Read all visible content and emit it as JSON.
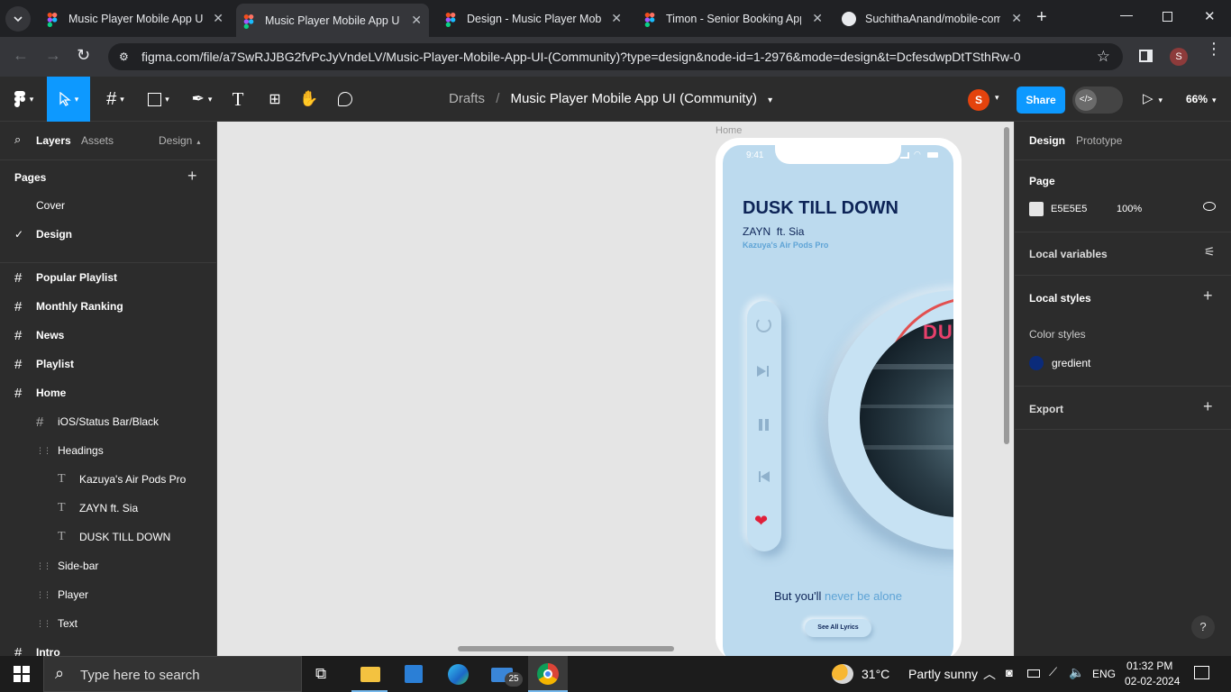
{
  "browser": {
    "tabs": [
      {
        "title": "Music Player Mobile App UI",
        "icon": "figma-icon",
        "active": false
      },
      {
        "title": "Music Player Mobile App UI",
        "icon": "figma-icon",
        "active": true
      },
      {
        "title": "Design - Music Player Mobil",
        "icon": "figma-icon",
        "active": false
      },
      {
        "title": "Timon - Senior Booking App",
        "icon": "figma-icon",
        "active": false
      },
      {
        "title": "SuchithaAnand/mobile-com",
        "icon": "github-icon",
        "active": false
      }
    ],
    "url": "figma.com/file/a7SwRJJBG2fvPcJyVndeLV/Music-Player-Mobile-App-UI-(Community)?type=design&node-id=1-2976&mode=design&t=DcfesdwpDtTSthRw-0",
    "profile_initial": "S"
  },
  "figma": {
    "breadcrumb_root": "Drafts",
    "breadcrumb_sep": "/",
    "file_name": "Music Player Mobile App UI (Community)",
    "user_initial": "S",
    "share_label": "Share",
    "zoom": "66%",
    "left_tabs": {
      "layers": "Layers",
      "assets": "Assets",
      "design": "Design"
    },
    "pages_title": "Pages",
    "pages": [
      {
        "name": "Cover",
        "selected": false
      },
      {
        "name": "Design",
        "selected": true
      }
    ],
    "layers": [
      {
        "name": "Popular Playlist",
        "type": "frame",
        "depth": 0
      },
      {
        "name": "Monthly Ranking",
        "type": "frame",
        "depth": 0
      },
      {
        "name": "News",
        "type": "frame",
        "depth": 0
      },
      {
        "name": "Playlist",
        "type": "frame",
        "depth": 0
      },
      {
        "name": "Home",
        "type": "frame",
        "depth": 0
      },
      {
        "name": "iOS/Status Bar/Black",
        "type": "frame",
        "depth": 1
      },
      {
        "name": "Headings",
        "type": "group",
        "depth": 1
      },
      {
        "name": "Kazuya's Air Pods Pro",
        "type": "text",
        "depth": 2
      },
      {
        "name": "ZAYN ft. Sia",
        "type": "text",
        "depth": 2
      },
      {
        "name": "DUSK TILL DOWN",
        "type": "text",
        "depth": 2
      },
      {
        "name": "Side-bar",
        "type": "group",
        "depth": 1
      },
      {
        "name": "Player",
        "type": "group",
        "depth": 1
      },
      {
        "name": "Text",
        "type": "group",
        "depth": 1
      },
      {
        "name": "Intro",
        "type": "frame",
        "depth": 0
      }
    ],
    "right_tabs": {
      "design": "Design",
      "prototype": "Prototype"
    },
    "page_section": {
      "title": "Page",
      "color_hex": "E5E5E5",
      "opacity": "100%"
    },
    "local_variables": "Local variables",
    "local_styles": "Local styles",
    "color_styles": "Color styles",
    "color_style_name": "gredient",
    "export": "Export",
    "help": "?"
  },
  "artboard": {
    "frame_label": "Home",
    "time": "9:41",
    "song_title": "DUSK TILL DOWN",
    "artist": "ZAYN  ft. Sia",
    "device": "Kazuya's Air Pods Pro",
    "lyric_prefix": "But you'll ",
    "lyric_highlight": "never be alone",
    "lyrics_button": "See All Lyrics",
    "album_text": "DUSK"
  },
  "taskbar": {
    "search_placeholder": "Type here to search",
    "mail_badge": "25",
    "weather_temp": "31°C",
    "weather_desc": "Partly sunny",
    "lang": "ENG",
    "time": "01:32 PM",
    "date": "02-02-2024"
  },
  "colors": {
    "figma_panel": "#2c2c2c",
    "share_blue": "#0d99ff",
    "canvas": "#e5e5e5",
    "phone_bg": "#bcdaee",
    "title_navy": "#0d2457",
    "accent_blue": "#5fa4d6",
    "heart_red": "#e0203a"
  }
}
